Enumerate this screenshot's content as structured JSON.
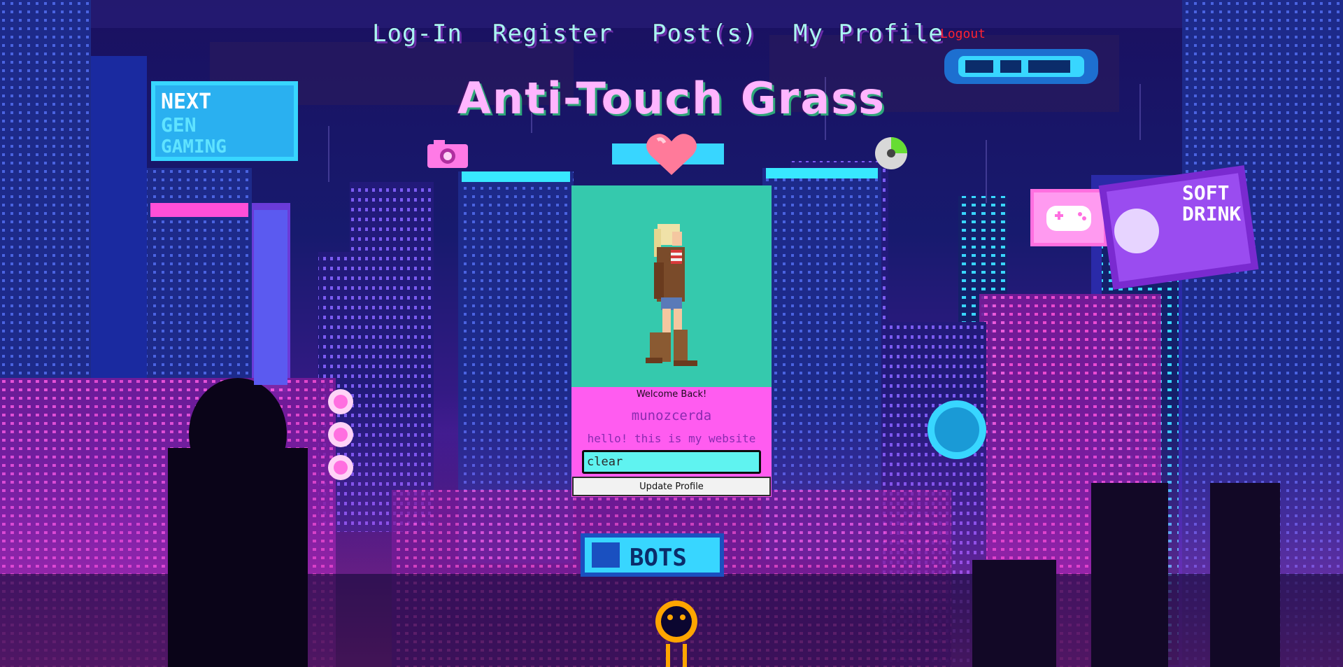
{
  "nav": {
    "login": "Log-In",
    "register": "Register",
    "posts": "Post(s)",
    "profile": "My Profile",
    "logout": "Logout"
  },
  "title": "Anti-Touch Grass",
  "signs": {
    "next_gen": [
      "NEXT",
      "GEN",
      "GAMING"
    ],
    "bots": "BOTS",
    "soft_drink": [
      "SOFT",
      "DRINK"
    ]
  },
  "profile": {
    "welcome": "Welcome Back!",
    "username": "munozcerda",
    "bio": "hello! this is my website",
    "input_value": "clear",
    "update_button": "Update Profile"
  },
  "colors": {
    "nav_text": "#a9f5f3",
    "logout": "#ff2230",
    "title": "#ffb5ff",
    "card_top": "#35c9ad",
    "card_bottom": "#ff5cf0",
    "input_bg": "#5ff3f0"
  },
  "icons": [
    "camera-icon",
    "heart-icon",
    "cd-icon",
    "gamepad-icon"
  ]
}
